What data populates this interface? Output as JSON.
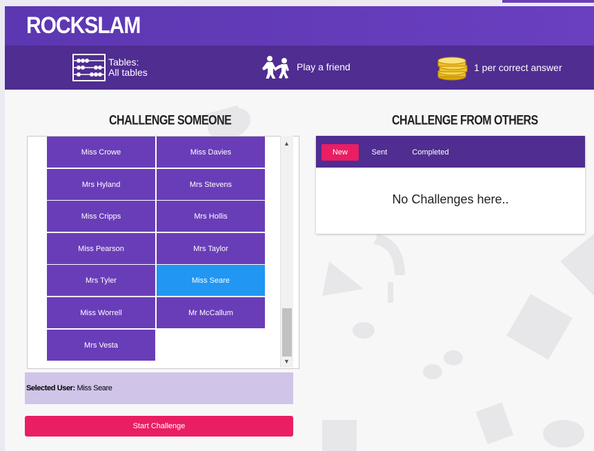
{
  "app": {
    "title": "ROCKSLAM"
  },
  "infobar": {
    "tables_label": "Tables:",
    "tables_value": "All tables",
    "mode": "Play a friend",
    "reward": "1 per correct answer"
  },
  "challenge_someone": {
    "title": "CHALLENGE SOMEONE",
    "users": [
      "Miss Crowe",
      "Miss Davies",
      "Mrs Hyland",
      "Mrs Stevens",
      "Miss Cripps",
      "Mrs Hollis",
      "Miss Pearson",
      "Mrs Taylor",
      "Mrs Tyler",
      "Miss Seare",
      "Miss Worrell",
      "Mr McCallum",
      "Mrs Vesta"
    ],
    "selected_prefix": "Selected User:",
    "selected_user": "Miss Seare",
    "start_button": "Start Challenge"
  },
  "challenges_from_others": {
    "title": "CHALLENGE FROM OTHERS",
    "tabs": [
      "New",
      "Sent",
      "Completed"
    ],
    "active_tab": "New",
    "empty_message": "No Challenges here.."
  },
  "colors": {
    "header": "#6a3fc0",
    "infobar": "#4f2d91",
    "cell": "#6a3db8",
    "selected_cell": "#2196f3",
    "accent": "#e91e63",
    "selected_bar": "#d0c4e8"
  },
  "icons": {
    "tables": "abacus-icon",
    "mode": "dancing-people-icon",
    "reward": "gold-coins-icon"
  }
}
